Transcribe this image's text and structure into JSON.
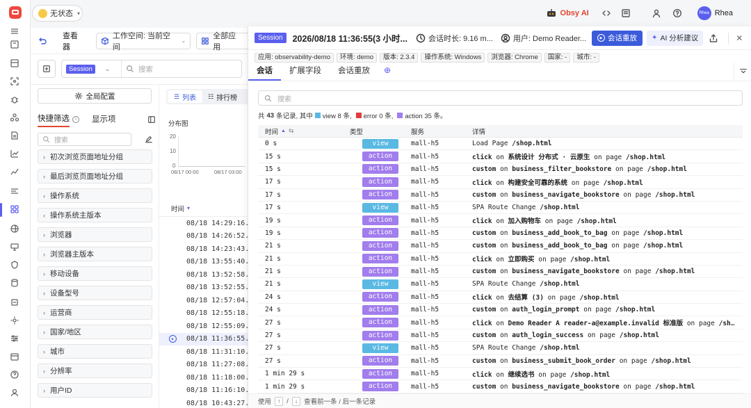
{
  "colors": {
    "accent": "#5b5fee",
    "view": "#5ab9e3",
    "action": "#a17ded",
    "error": "#e03d3d",
    "session_tag": "#5b5fee",
    "brand_red": "#f0483e"
  },
  "header": {
    "status_label": "无状态",
    "obsy_ai": "Obsy AI",
    "user_name": "Rhea",
    "avatar_text": "Rhea"
  },
  "viewer": {
    "title": "查看器",
    "workspace": "工作空间: 当前空间",
    "apps": "全部应用",
    "session_select": "Session",
    "search_placeholder": "搜索"
  },
  "filters": {
    "global_config": "全局配置",
    "tab_quick": "快捷筛选",
    "tab_display": "显示项",
    "search_placeholder": "搜索",
    "groups": [
      "初次浏览页面地址分组",
      "最后浏览页面地址分组",
      "操作系统",
      "操作系统主版本",
      "浏览器",
      "浏览器主版本",
      "移动设备",
      "设备型号",
      "运营商",
      "国家/地区",
      "城市",
      "分辨率",
      "用户ID"
    ]
  },
  "list": {
    "tab_list": "列表",
    "tab_rank": "排行榜",
    "dist_title": "分布图",
    "y_ticks": [
      "20",
      "10",
      "0"
    ],
    "x_ticks": [
      "08/17 00:00",
      "08/17 03:00"
    ],
    "time_header": "时间",
    "times": [
      "08/18 14:29:16.8",
      "08/18 14:26:52.8",
      "08/18 14:23:43.0",
      "08/18 13:55:40.0",
      "08/18 13:52:58.7",
      "08/18 13:52:55.7",
      "08/18 12:57:04.4",
      "08/18 12:55:18.2",
      "08/18 12:55:09.8",
      "08/18 11:36:55.2",
      "08/18 11:31:10.2",
      "08/18 11:27:08.5",
      "08/18 11:18:00.4",
      "08/18 11:16:10.4",
      "08/18 10:43:27.2"
    ],
    "selected_index": 9
  },
  "panel": {
    "badge": "Session",
    "datetime": "2026/08/18 11:36:55(3 小时...",
    "duration": "会话时长: 9.16 m...",
    "user": "用户: Demo Reader...",
    "replay_button": "会话重放",
    "ai_button": "AI 分析建议",
    "tags": [
      "应用: observability-demo",
      "环境: demo",
      "版本: 2.3.4",
      "操作系统: Windows",
      "浏览器: Chrome",
      "国家: -",
      "城市: -"
    ],
    "tabs": [
      "会话",
      "扩展字段",
      "会话重放"
    ],
    "search_placeholder": "搜索",
    "summary": {
      "prefix": "共",
      "total": "43",
      "mid": "条记录, 其中",
      "view": "view 8 条,",
      "error": "error 0 条,",
      "action": "action 35 条。"
    },
    "columns": [
      "时间",
      "类型",
      "服务",
      "详情"
    ],
    "rows": [
      {
        "t": "0 s",
        "type": "view",
        "svc": "mall-h5",
        "a": "Load Page",
        "b": "",
        "c": "/shop.html"
      },
      {
        "t": "15 s",
        "type": "action",
        "svc": "mall-h5",
        "a": "click",
        "b": "系统设计 分布式 · 云原生",
        "c": "/shop.html"
      },
      {
        "t": "15 s",
        "type": "action",
        "svc": "mall-h5",
        "a": "custom",
        "b": "business_filter_bookstore",
        "c": "/shop.html"
      },
      {
        "t": "17 s",
        "type": "action",
        "svc": "mall-h5",
        "a": "click",
        "b": "构建安全可靠的系统",
        "c": "/shop.html"
      },
      {
        "t": "17 s",
        "type": "action",
        "svc": "mall-h5",
        "a": "custom",
        "b": "business_navigate_bookstore",
        "c": "/shop.html"
      },
      {
        "t": "17 s",
        "type": "view",
        "svc": "mall-h5",
        "a": "SPA Route Change",
        "b": "",
        "c": "/shop.html"
      },
      {
        "t": "19 s",
        "type": "action",
        "svc": "mall-h5",
        "a": "click",
        "b": "加入购物车",
        "c": "/shop.html"
      },
      {
        "t": "19 s",
        "type": "action",
        "svc": "mall-h5",
        "a": "custom",
        "b": "business_add_book_to_bag",
        "c": "/shop.html"
      },
      {
        "t": "21 s",
        "type": "action",
        "svc": "mall-h5",
        "a": "custom",
        "b": "business_add_book_to_bag",
        "c": "/shop.html"
      },
      {
        "t": "21 s",
        "type": "action",
        "svc": "mall-h5",
        "a": "click",
        "b": "立即购买",
        "c": "/shop.html"
      },
      {
        "t": "21 s",
        "type": "action",
        "svc": "mall-h5",
        "a": "custom",
        "b": "business_navigate_bookstore",
        "c": "/shop.html"
      },
      {
        "t": "21 s",
        "type": "view",
        "svc": "mall-h5",
        "a": "SPA Route Change",
        "b": "",
        "c": "/shop.html"
      },
      {
        "t": "24 s",
        "type": "action",
        "svc": "mall-h5",
        "a": "click",
        "b": "去结算 (3)",
        "c": "/shop.html"
      },
      {
        "t": "24 s",
        "type": "action",
        "svc": "mall-h5",
        "a": "custom",
        "b": "auth_login_prompt",
        "c": "/shop.html"
      },
      {
        "t": "27 s",
        "type": "action",
        "svc": "mall-h5",
        "a": "click",
        "b": "Demo Reader A reader-a@example.invalid 标准版",
        "c": "/sho..."
      },
      {
        "t": "27 s",
        "type": "action",
        "svc": "mall-h5",
        "a": "custom",
        "b": "auth_login_success",
        "c": "/shop.html"
      },
      {
        "t": "27 s",
        "type": "view",
        "svc": "mall-h5",
        "a": "SPA Route Change",
        "b": "",
        "c": "/shop.html"
      },
      {
        "t": "27 s",
        "type": "action",
        "svc": "mall-h5",
        "a": "custom",
        "b": "business_submit_book_order",
        "c": "/shop.html"
      },
      {
        "t": "1 min 29 s",
        "type": "action",
        "svc": "mall-h5",
        "a": "click",
        "b": "继续选书",
        "c": "/shop.html"
      },
      {
        "t": "1 min 29 s",
        "type": "action",
        "svc": "mall-h5",
        "a": "custom",
        "b": "business_navigate_bookstore",
        "c": "/shop.html"
      }
    ],
    "on_word": "on",
    "on_page": "on page",
    "footer": {
      "use": "使用",
      "up": "↑",
      "slash": "/",
      "down": "↓",
      "hint": "查看前一条 / 后一条记录"
    }
  }
}
